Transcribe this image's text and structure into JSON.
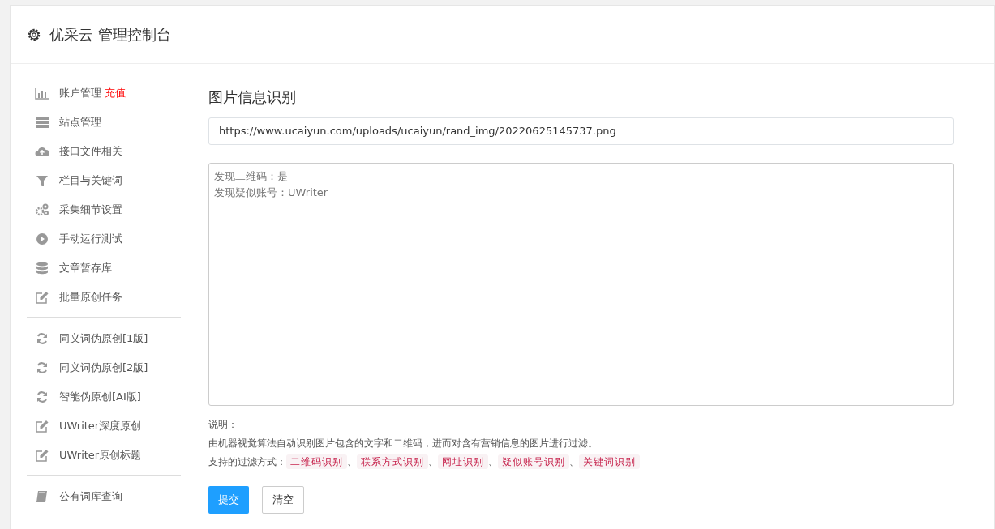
{
  "header": {
    "title": "优采云 管理控制台"
  },
  "sidebar": {
    "groups": [
      {
        "items": [
          {
            "kind": "chart",
            "label": "账户管理",
            "badge": "充值"
          },
          {
            "kind": "server",
            "label": "站点管理"
          },
          {
            "kind": "cloud",
            "label": "接口文件相关"
          },
          {
            "kind": "filter",
            "label": "栏目与关键词"
          },
          {
            "kind": "gears",
            "label": "采集细节设置"
          },
          {
            "kind": "play",
            "label": "手动运行测试"
          },
          {
            "kind": "database",
            "label": "文章暂存库"
          },
          {
            "kind": "edit",
            "label": "批量原创任务"
          }
        ]
      },
      {
        "items": [
          {
            "kind": "refresh",
            "label": "同义词伪原创[1版]"
          },
          {
            "kind": "refresh",
            "label": "同义词伪原创[2版]"
          },
          {
            "kind": "refresh",
            "label": "智能伪原创[AI版]"
          },
          {
            "kind": "edit",
            "label": "UWriter深度原创"
          },
          {
            "kind": "edit",
            "label": "UWriter原创标题"
          }
        ]
      },
      {
        "items": [
          {
            "kind": "book",
            "label": "公有词库查询"
          }
        ]
      }
    ]
  },
  "main": {
    "title": "图片信息识别",
    "url_field": {
      "value": "https://www.ucaiyun.com/uploads/ucaiyun/rand_img/20220625145737.png"
    },
    "result": {
      "lines": [
        "发现二维码：是",
        "发现疑似账号：UWriter"
      ]
    },
    "note": {
      "heading": "说明：",
      "text": "由机器视觉算法自动识别图片包含的文字和二维码，进而对含有营销信息的图片进行过滤。",
      "methods_label": "支持的过滤方式：",
      "methods": [
        "二维码识别",
        "联系方式识别",
        "网址识别",
        "疑似账号识别",
        "关键词识别"
      ],
      "separator": "、"
    },
    "buttons": [
      {
        "label": "提交",
        "kind": "primary"
      },
      {
        "label": "清空",
        "kind": "secondary"
      }
    ]
  }
}
